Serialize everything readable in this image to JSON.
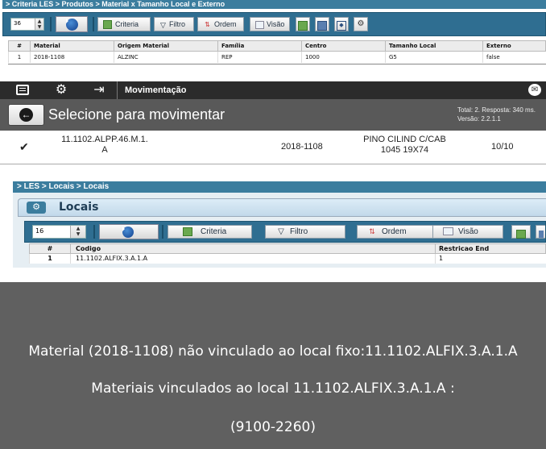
{
  "panel1": {
    "breadcrumb": "> Criteria LES > Produtos > Material x Tamanho Local e Externo",
    "page_size": "36",
    "toolbar": {
      "criteria": "Criteria",
      "filtro": "Filtro",
      "ordem": "Ordem",
      "visao": "Visão"
    },
    "table": {
      "headers": [
        "#",
        "Material",
        "Origem Material",
        "Família",
        "Centro",
        "Tamanho Local",
        "Externo"
      ],
      "rows": [
        [
          "1",
          "2018-1108",
          "ALZINC",
          "REP",
          "1000",
          "G5",
          "false"
        ]
      ]
    }
  },
  "panel2": {
    "top_title": "Movimentação",
    "heading": "Selecione para movimentar",
    "total": "Total: 2. Resposta: 340 ms.",
    "version": "Versão: 2.2.1.1",
    "row": {
      "location_line1": "11.1102.ALPP.46.M.1.",
      "location_line2": "A",
      "material": "2018-1108",
      "description_line1": "PINO CILIND C/CAB",
      "description_line2": "1045 19X74",
      "quantity": "10/10"
    }
  },
  "panel3": {
    "breadcrumb": "> LES > Locais > Locais",
    "title": "Locais",
    "page_size": "16",
    "toolbar": {
      "criteria": "Criteria",
      "filtro": "Filtro",
      "ordem": "Ordem",
      "visao": "Visão"
    },
    "table": {
      "headers": [
        "#",
        "Codigo",
        "Restricao End"
      ],
      "rows": [
        [
          "1",
          "11.1102.ALFIX.3.A.1.A",
          "1"
        ]
      ]
    }
  },
  "panel4": {
    "line1": "Material (2018-1108) não vinculado ao local fixo:11.1102.ALFIX.3.A.1.A",
    "line2": "Materiais vinculados ao local 11.1102.ALFIX.3.A.1.A :",
    "line3": "(9100-2260)"
  },
  "colors": {
    "header_blue": "#3b7d9e",
    "toolbar_blue": "#2f6e91",
    "dark_bar": "#2b2b2b",
    "gray_bar": "#595959",
    "message_bg": "#606060",
    "play_blue": "#1a56b0"
  }
}
